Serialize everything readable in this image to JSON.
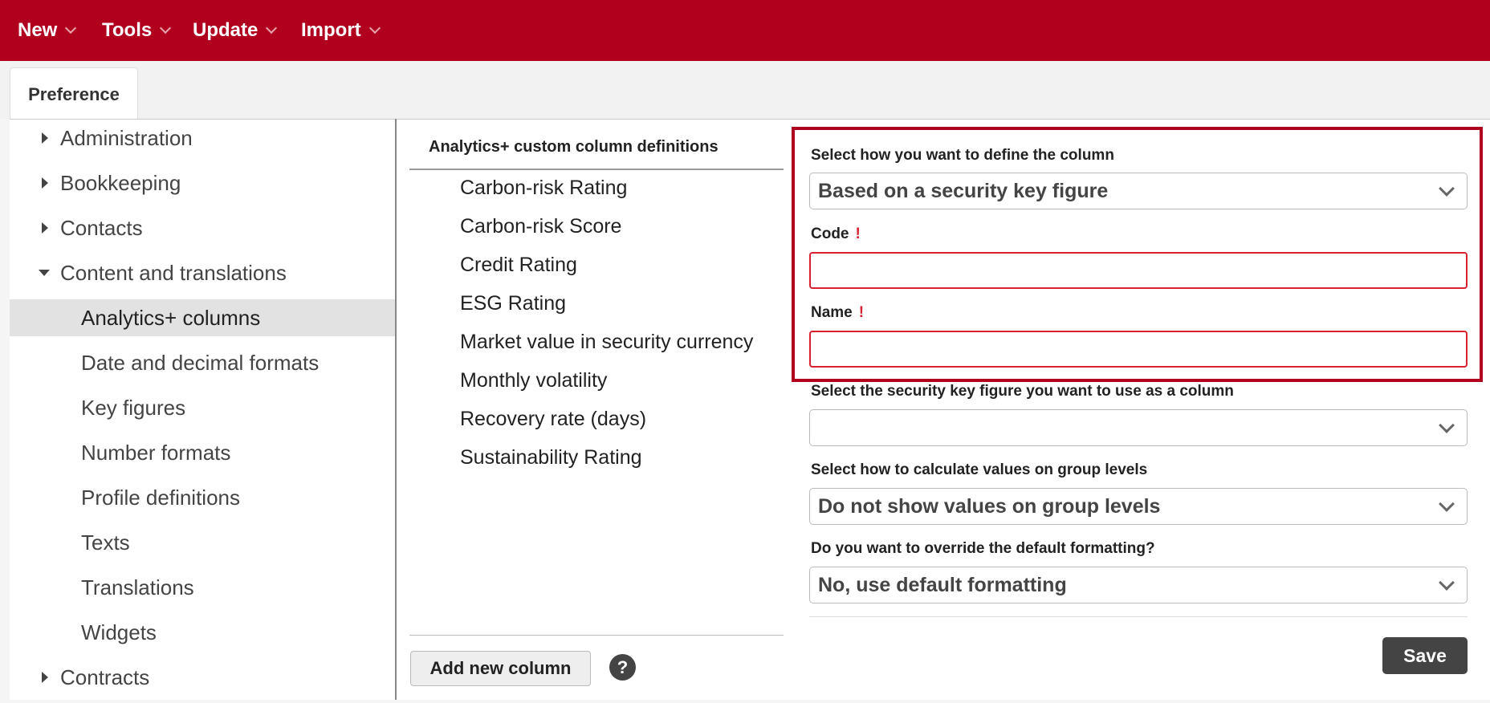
{
  "menu": [
    {
      "label": "New"
    },
    {
      "label": "Tools"
    },
    {
      "label": "Update"
    },
    {
      "label": "Import"
    }
  ],
  "tab": {
    "label": "Preference"
  },
  "sidebar": {
    "items": [
      {
        "label": "Administration",
        "expanded": false
      },
      {
        "label": "Bookkeeping",
        "expanded": false
      },
      {
        "label": "Contacts",
        "expanded": false
      },
      {
        "label": "Content and translations",
        "expanded": true
      },
      {
        "label": "Analytics+ columns",
        "selected": true
      },
      {
        "label": "Date and decimal formats"
      },
      {
        "label": "Key figures"
      },
      {
        "label": "Number formats"
      },
      {
        "label": "Profile definitions"
      },
      {
        "label": "Texts"
      },
      {
        "label": "Translations"
      },
      {
        "label": "Widgets"
      },
      {
        "label": "Contracts",
        "expanded": false
      }
    ]
  },
  "columns": {
    "header": "Analytics+ custom column definitions",
    "items": [
      "Carbon-risk Rating",
      "Carbon-risk Score",
      "Credit Rating",
      "ESG Rating",
      "Market value in security currency",
      "Monthly volatility",
      "Recovery rate (days)",
      "Sustainability Rating"
    ],
    "add_label": "Add new column",
    "help_symbol": "?"
  },
  "form": {
    "define_label": "Select how you want to define the column",
    "define_value": "Based on a security key figure",
    "code_label": "Code",
    "code_value": "",
    "name_label": "Name",
    "name_value": "",
    "required_mark": "!",
    "keyfigure_label": "Select the security key figure you want to use as a column",
    "keyfigure_value": "",
    "group_label": "Select how to calculate values on group levels",
    "group_value": "Do not show values on group levels",
    "format_label": "Do you want to override the default formatting?",
    "format_value": "No, use default formatting",
    "save_label": "Save"
  },
  "colors": {
    "brand": "#b0001e",
    "required": "#d8202f",
    "selected_row": "#e2e2e2"
  }
}
